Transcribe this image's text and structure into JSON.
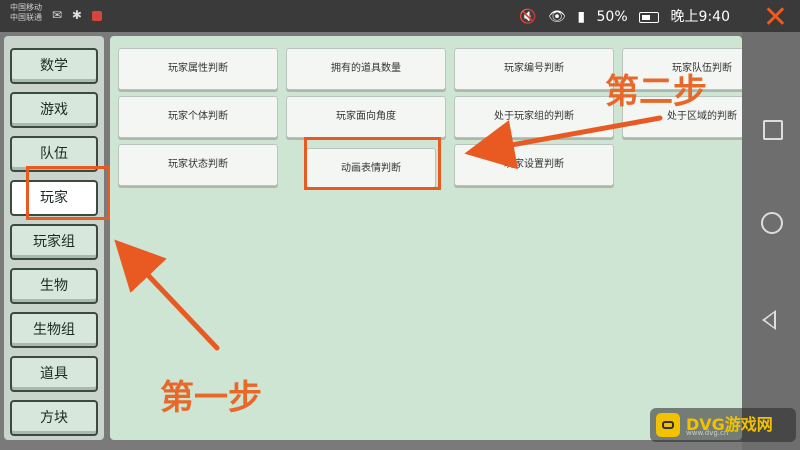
{
  "status_bar": {
    "carrier_line1": "中国移动",
    "carrier_line2": "中国联通",
    "battery": "50%",
    "time": "晚上9:40",
    "close_symbol": "✕"
  },
  "sidebar": {
    "items": [
      {
        "label": "数学"
      },
      {
        "label": "游戏"
      },
      {
        "label": "队伍"
      },
      {
        "label": "玩家"
      },
      {
        "label": "玩家组"
      },
      {
        "label": "生物"
      },
      {
        "label": "生物组"
      },
      {
        "label": "道具"
      },
      {
        "label": "方块"
      }
    ],
    "active": "玩家"
  },
  "grid": {
    "buttons": [
      {
        "label": "玩家属性判断"
      },
      {
        "label": "拥有的道具数量"
      },
      {
        "label": "玩家编号判断"
      },
      {
        "label": "玩家队伍判断"
      },
      {
        "label": "玩家个体判断"
      },
      {
        "label": "玩家面向角度"
      },
      {
        "label": "处于玩家组的判断"
      },
      {
        "label": "处于区域的判断"
      },
      {
        "label": "玩家状态判断"
      },
      {
        "label": "动画表情判断"
      },
      {
        "label": "玩家设置判断"
      }
    ]
  },
  "annotations": {
    "step1": "第一步",
    "step2": "第二步",
    "color": "#e85a22"
  },
  "watermark": {
    "title": "DVG游戏网",
    "sub": "www.dvg.cn"
  }
}
